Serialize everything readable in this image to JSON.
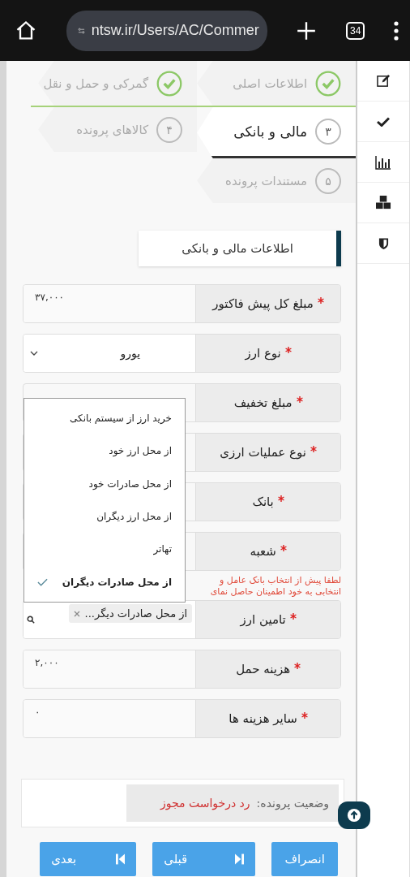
{
  "browser": {
    "url": "ntsw.ir/Users/AC/Commer",
    "tab_count": "34"
  },
  "steps": [
    {
      "label": "اطلاعات اصلی",
      "done": true,
      "selected": false
    },
    {
      "label": "گمرکی و حمل و نقل",
      "done": true,
      "selected": false
    },
    {
      "number": "۳",
      "label": "مالی و بانکی",
      "done": false,
      "selected": true
    },
    {
      "number": "۴",
      "label": "کالاهای پرونده",
      "done": false,
      "selected": false
    },
    {
      "number": "۵",
      "label": "مستندات پرونده",
      "done": false,
      "selected": false
    }
  ],
  "section_title": "اطلاعات مالی و بانکی",
  "fields": [
    {
      "label": "مبلغ کل پیش فاکتور",
      "required": true,
      "kind": "text",
      "value": "۳۷,۰۰۰"
    },
    {
      "label": "نوع ارز",
      "required": true,
      "kind": "select",
      "value": "یورو"
    },
    {
      "label": "مبلغ تخفیف",
      "required": true,
      "kind": "covered"
    },
    {
      "label": "نوع عملیات ارزی",
      "required": true,
      "kind": "covered"
    },
    {
      "label": "بانک",
      "required": true,
      "kind": "covered"
    },
    {
      "label": "شعبه",
      "required": true,
      "kind": "covered"
    },
    {
      "kind": "warning",
      "lines": [
        "لطفا پیش از انتخاب بانک عامل و",
        "انتخابی به خود اطمینان حاصل نمای"
      ]
    },
    {
      "label": "تامین ارز",
      "required": true,
      "kind": "tags",
      "value": "از محل صادرات دیگر..."
    },
    {
      "label": "هزینه حمل",
      "required": true,
      "kind": "text",
      "value": "۲,۰۰۰"
    },
    {
      "label": "سایر هزینه ها",
      "required": true,
      "kind": "text",
      "value": "۰"
    }
  ],
  "dropdown_options": [
    {
      "label": "خرید ارز از سیستم بانکی",
      "selected": false
    },
    {
      "label": "از محل ارز خود",
      "selected": false
    },
    {
      "label": "از محل صادرات خود",
      "selected": false
    },
    {
      "label": "از محل ارز دیگران",
      "selected": false
    },
    {
      "label": "تهاتر",
      "selected": false
    },
    {
      "label": "از محل صادرات دیگران",
      "selected": true
    }
  ],
  "status": {
    "label": "وضعیت پرونده:",
    "value": "رد درخواست مجوز"
  },
  "buttons": [
    {
      "label": "انصراف",
      "kind": "plain"
    },
    {
      "label": "قبلی",
      "kind": "prev"
    },
    {
      "label": "بعدی",
      "kind": "next"
    }
  ]
}
